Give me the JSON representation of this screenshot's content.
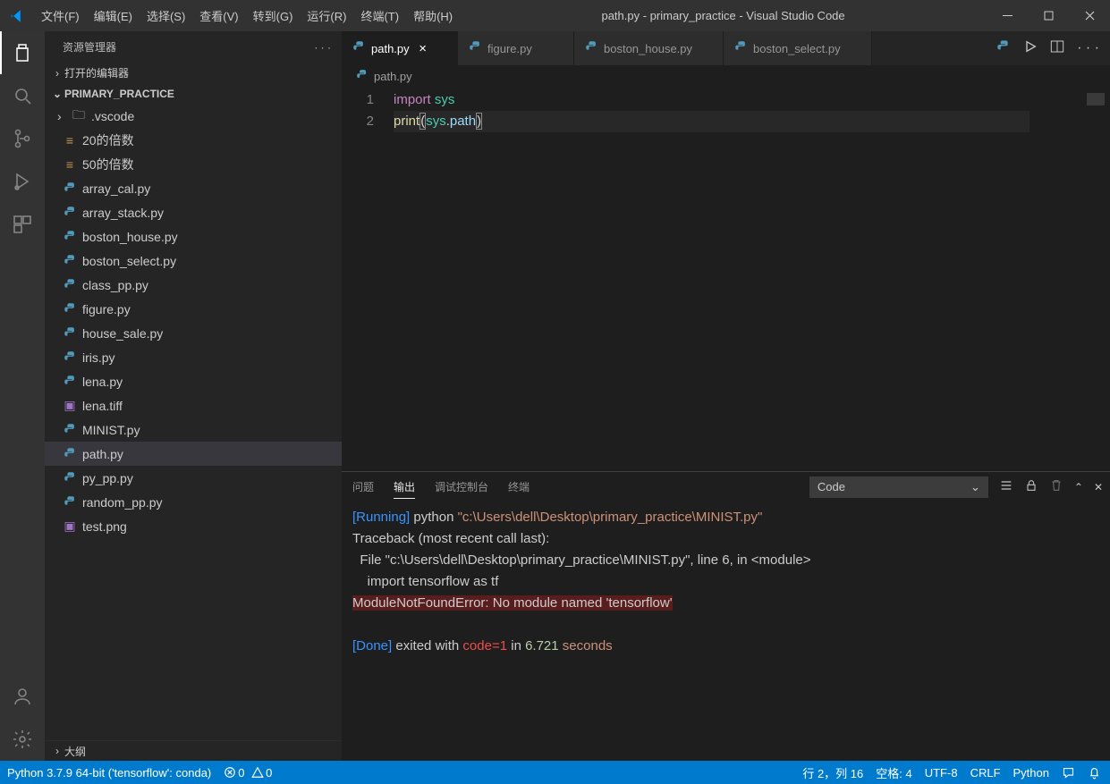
{
  "title": "path.py - primary_practice - Visual Studio Code",
  "menu": [
    "文件(F)",
    "编辑(E)",
    "选择(S)",
    "查看(V)",
    "转到(G)",
    "运行(R)",
    "终端(T)",
    "帮助(H)"
  ],
  "sidebar": {
    "title": "资源管理器",
    "sections": {
      "openEditors": "打开的编辑器",
      "workspace": "PRIMARY_PRACTICE",
      "outline": "大纲"
    },
    "tree": [
      {
        "label": ".vscode",
        "type": "folder"
      },
      {
        "label": "20的倍数",
        "type": "file-generic"
      },
      {
        "label": "50的倍数",
        "type": "file-generic"
      },
      {
        "label": "array_cal.py",
        "type": "py"
      },
      {
        "label": "array_stack.py",
        "type": "py"
      },
      {
        "label": "boston_house.py",
        "type": "py"
      },
      {
        "label": "boston_select.py",
        "type": "py"
      },
      {
        "label": "class_pp.py",
        "type": "py"
      },
      {
        "label": "figure.py",
        "type": "py"
      },
      {
        "label": "house_sale.py",
        "type": "py"
      },
      {
        "label": "iris.py",
        "type": "py"
      },
      {
        "label": "lena.py",
        "type": "py"
      },
      {
        "label": "lena.tiff",
        "type": "img"
      },
      {
        "label": "MINIST.py",
        "type": "py"
      },
      {
        "label": "path.py",
        "type": "py",
        "selected": true
      },
      {
        "label": "py_pp.py",
        "type": "py"
      },
      {
        "label": "random_pp.py",
        "type": "py"
      },
      {
        "label": "test.png",
        "type": "img"
      }
    ]
  },
  "tabs": [
    {
      "label": "path.py",
      "active": true
    },
    {
      "label": "figure.py",
      "active": false
    },
    {
      "label": "boston_house.py",
      "active": false
    },
    {
      "label": "boston_select.py",
      "active": false
    }
  ],
  "breadcrumb": "path.py",
  "code": {
    "lines": [
      {
        "num": "1",
        "tokens": [
          {
            "t": "import",
            "c": "kw"
          },
          {
            "t": " ",
            "c": "p"
          },
          {
            "t": "sys",
            "c": "mod"
          }
        ]
      },
      {
        "num": "2",
        "tokens": [
          {
            "t": "print",
            "c": "fn"
          },
          {
            "t": "(",
            "c": "pm"
          },
          {
            "t": "sys",
            "c": "mod"
          },
          {
            "t": ".",
            "c": "p"
          },
          {
            "t": "path",
            "c": "var"
          },
          {
            "t": ")",
            "c": "pm"
          }
        ],
        "current": true
      }
    ]
  },
  "panel": {
    "tabs": [
      "问题",
      "输出",
      "调试控制台",
      "终端"
    ],
    "activeTab": 1,
    "selectLabel": "Code",
    "output": {
      "runningLabel": "[Running]",
      "runningCmd": " python ",
      "runningPath": "\"c:\\Users\\dell\\Desktop\\primary_practice\\MINIST.py\"",
      "trace1": "Traceback (most recent call last):",
      "trace2": "  File \"c:\\Users\\dell\\Desktop\\primary_practice\\MINIST.py\", line 6, in <module>",
      "trace3": "    import tensorflow as tf",
      "error": "ModuleNotFoundError: No module named 'tensorflow'",
      "doneLabel": "[Done]",
      "doneText1": " exited with ",
      "doneCode": "code=1",
      "doneText2": " in ",
      "doneTime": "6.721",
      "doneText3": " seconds"
    }
  },
  "status": {
    "python": "Python 3.7.9 64-bit ('tensorflow': conda)",
    "errors": "0",
    "warnings": "0",
    "lncol": "行 2，列 16",
    "spaces": "空格: 4",
    "encoding": "UTF-8",
    "eol": "CRLF",
    "lang": "Python"
  }
}
